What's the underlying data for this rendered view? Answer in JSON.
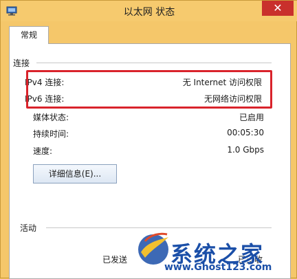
{
  "window": {
    "title": "以太网 状态",
    "close_glyph": "✕"
  },
  "tabs": [
    {
      "label": "常规"
    }
  ],
  "connection": {
    "section_label": "连接",
    "rows": [
      {
        "label": "IPv4 连接:",
        "value": "无 Internet 访问权限"
      },
      {
        "label": "IPv6 连接:",
        "value": "无网络访问权限"
      },
      {
        "label": "媒体状态:",
        "value": "已启用"
      },
      {
        "label": "持续时间:",
        "value": "00:05:30"
      },
      {
        "label": "速度:",
        "value": "1.0 Gbps"
      }
    ],
    "details_button": "详细信息(E)..."
  },
  "activity": {
    "section_label": "活动",
    "sent_label": "已发送",
    "received_label": "已接收"
  },
  "watermark": {
    "brand": "系统之家",
    "url": "www.Ghost123.com"
  },
  "colors": {
    "highlight": "#d9232b",
    "close_button": "#c9302c",
    "watermark": "#1b4fa8"
  }
}
